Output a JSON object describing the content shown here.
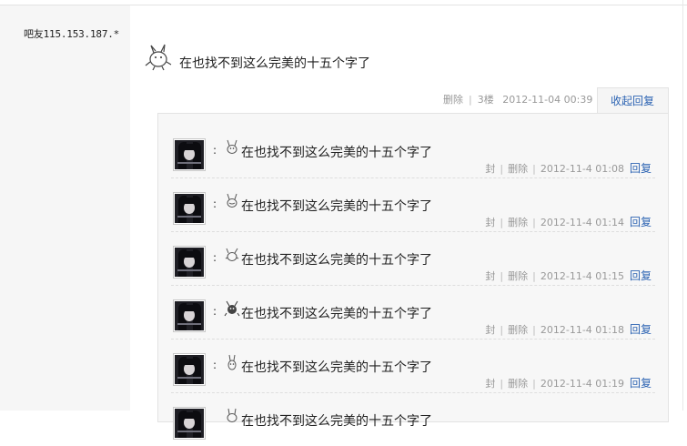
{
  "post": {
    "username": "吧友115.153.187.*",
    "text": "在也找不到这么完美的十五个字了",
    "delete_label": "删除",
    "floor": "3楼",
    "timestamp": "2012-11-04 00:39",
    "collapse_label": "收起回复"
  },
  "replies": [
    {
      "text": "在也找不到这么完美的十五个字了",
      "ban": "封",
      "delete": "删除",
      "time": "2012-11-4 01:08",
      "reply": "回复"
    },
    {
      "text": "在也找不到这么完美的十五个字了",
      "ban": "封",
      "delete": "删除",
      "time": "2012-11-4 01:14",
      "reply": "回复"
    },
    {
      "text": "在也找不到这么完美的十五个字了",
      "ban": "封",
      "delete": "删除",
      "time": "2012-11-4 01:15",
      "reply": "回复"
    },
    {
      "text": "在也找不到这么完美的十五个字了",
      "ban": "封",
      "delete": "删除",
      "time": "2012-11-4 01:18",
      "reply": "回复"
    },
    {
      "text": "在也找不到这么完美的十五个字了",
      "ban": "封",
      "delete": "删除",
      "time": "2012-11-4 01:19",
      "reply": "回复"
    },
    {
      "text": "在也找不到这么完美的十五个字了",
      "ban": "",
      "delete": "",
      "time": "",
      "reply": ""
    }
  ],
  "colon": ":",
  "icons": {
    "post_emoticon": "rabbit-emoticon-icon",
    "reply_emoticon": "rabbit-emoticon-icon",
    "avatar": "user-avatar"
  },
  "colors": {
    "link": "#2d64b3",
    "meta": "#999999",
    "sidebar": "#f6f6f6"
  }
}
